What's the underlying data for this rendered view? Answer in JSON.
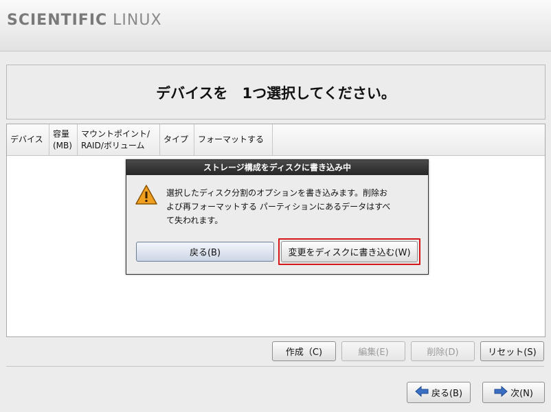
{
  "brand": {
    "part1": "SCIENTIFIC",
    "part2": "LINUX"
  },
  "page_title": "デバイスを　1つ選択してください。",
  "table": {
    "columns": [
      "デバイス",
      "容量\n(MB)",
      "マウントポイント/\nRAID/ボリューム",
      "タイプ",
      "フォーマットする"
    ]
  },
  "dialog": {
    "title": "ストレージ構成をディスクに書き込み中",
    "icon": "warning-icon",
    "message": "選択したディスク分割のオプションを書き込みます。削除および再フォーマットする パーティションにあるデータはすべて失われます。",
    "back_label": "戻る(B)",
    "write_label": "変更をディスクに書き込む(W)"
  },
  "actions": {
    "create": "作成（C)",
    "edit": "編集(E)",
    "delete": "削除(D)",
    "reset": "リセット(S)"
  },
  "nav": {
    "back": "戻る(B)",
    "next": "次(N)"
  },
  "colors": {
    "focus_ring": "#d4161a",
    "arrow_blue": "#3a6fc4",
    "warning": "#f0a020"
  }
}
